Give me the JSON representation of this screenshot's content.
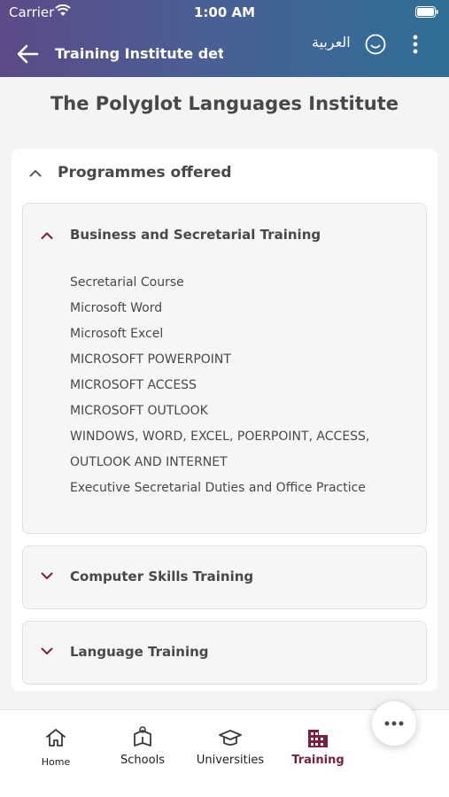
{
  "status_bar": {
    "carrier": "Carrier",
    "time": "1:00 AM"
  },
  "header": {
    "title": "Training Institute deta...",
    "language_toggle": "العربية",
    "icons": [
      "back-arrow-icon",
      "smile-icon",
      "more-vert-icon"
    ]
  },
  "institute": {
    "name": "The Polyglot Languages Institute"
  },
  "programmes": {
    "title": "Programmes offered",
    "categories": [
      {
        "title": "Business and Secretarial Training",
        "expanded": true,
        "items": [
          "Secretarial Course",
          "Microsoft Word",
          "Microsoft Excel",
          "MICROSOFT POWERPOINT",
          "MICROSOFT ACCESS",
          "MICROSOFT OUTLOOK",
          "WINDOWS, WORD, EXCEL, POERPOINT, ACCESS,",
          "OUTLOOK AND INTERNET",
          "Executive Secretarial Duties and Office Practice"
        ]
      },
      {
        "title": "Computer Skills Training",
        "expanded": false
      },
      {
        "title": "Language Training",
        "expanded": false
      }
    ]
  },
  "bottom_nav": [
    {
      "label": "Home",
      "icon": "home-icon",
      "active": false
    },
    {
      "label": "Schools",
      "icon": "school-icon",
      "active": false
    },
    {
      "label": "Universities",
      "icon": "graduation-cap-icon",
      "active": false
    },
    {
      "label": "Training",
      "icon": "building-icon",
      "active": true
    }
  ],
  "colors": {
    "header_gradient": [
      "#5c4a86",
      "#2f6f96"
    ],
    "accent": "#7a1f3d",
    "background": "#f4f4f5"
  }
}
